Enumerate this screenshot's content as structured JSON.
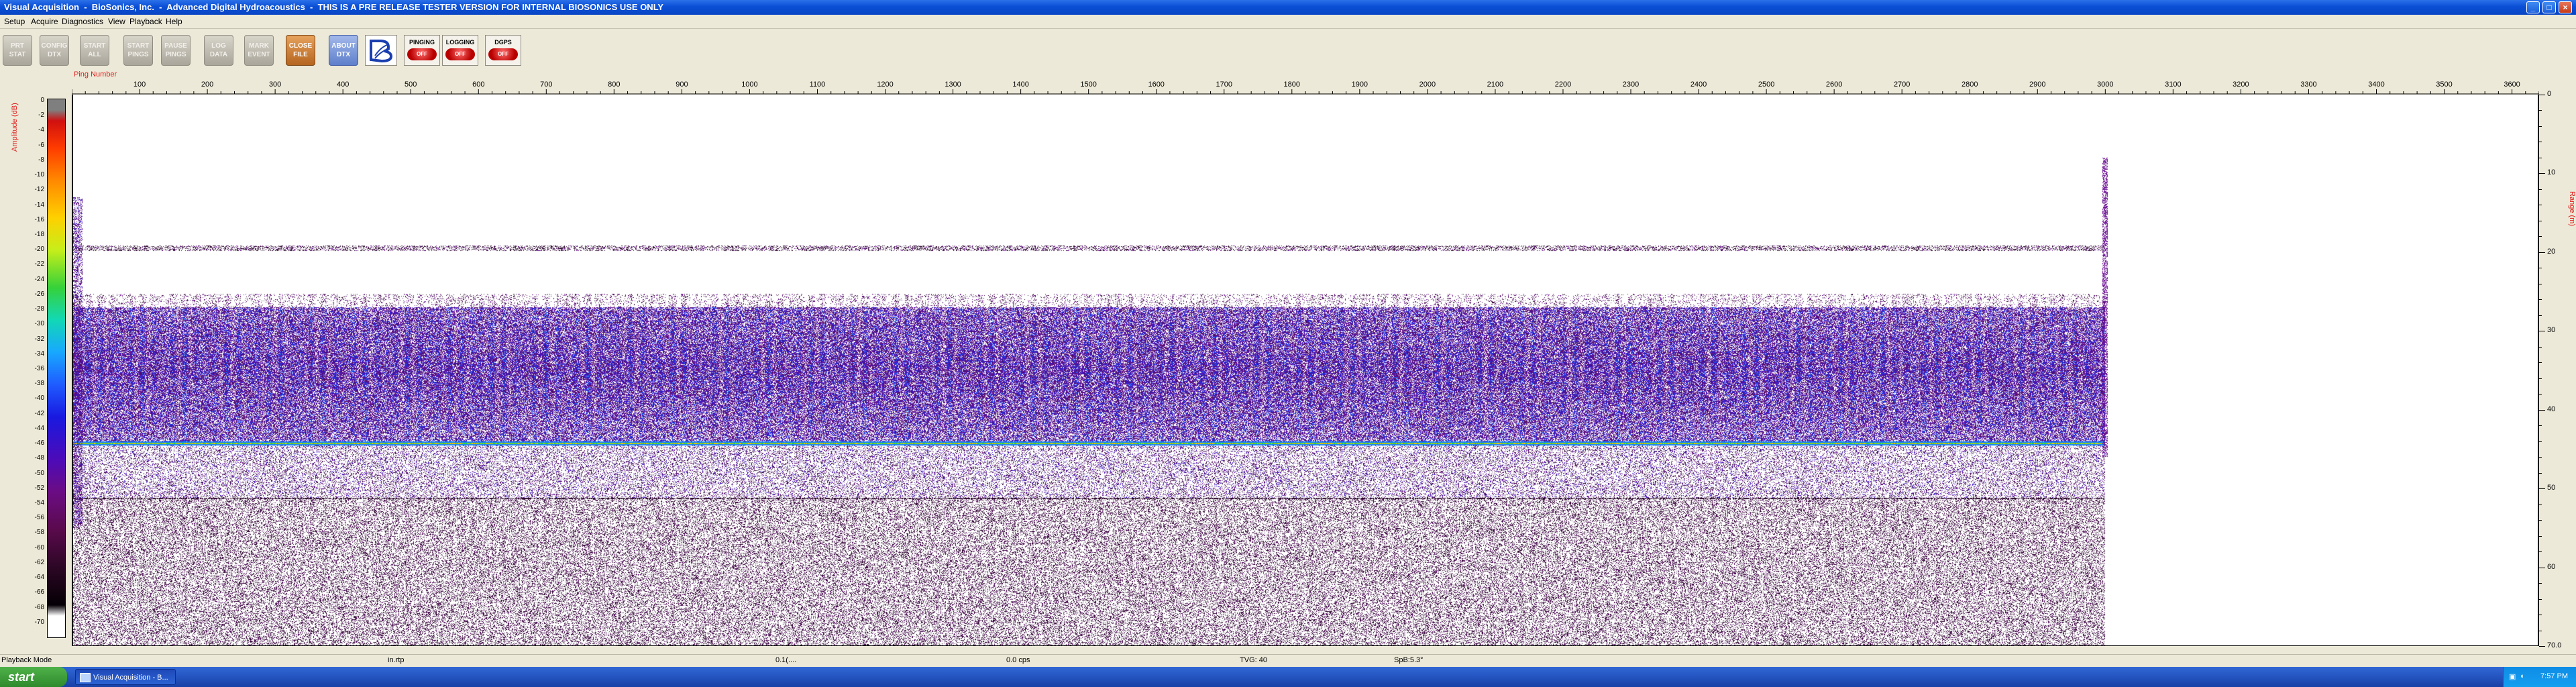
{
  "window": {
    "title": "Visual Acquisition  -  BioSonics, Inc.  -  Advanced Digital Hydroacoustics  -  THIS IS A PRE RELEASE TESTER VERSION FOR INTERNAL BIOSONICS USE ONLY",
    "minimize_label": "_",
    "maximize_label": "□",
    "close_label": "×"
  },
  "menu": [
    "Setup",
    "Acquire",
    "Diagnostics",
    "View",
    "Playback",
    "Help"
  ],
  "toolbar": {
    "buttons": [
      {
        "label": "PRT\nSTAT",
        "style": "gray"
      },
      {
        "label": "CONFIG\nDTX",
        "style": "gray"
      },
      {
        "label": "START\nALL",
        "style": "gray"
      },
      {
        "label": "START\nPINGS",
        "style": "gray"
      },
      {
        "label": "PAUSE\nPINGS",
        "style": "gray"
      },
      {
        "label": "LOG\nDATA",
        "style": "gray"
      },
      {
        "label": "MARK\nEVENT",
        "style": "gray"
      },
      {
        "label": "CLOSE\nFILE",
        "style": "orange"
      },
      {
        "label": "ABOUT\nDTX",
        "style": "blue"
      }
    ],
    "logo_icon": "biosonics-logo-icon",
    "indicators": [
      {
        "label": "PINGING",
        "state": "OFF",
        "color": "#c00000"
      },
      {
        "label": "LOGGING",
        "state": "OFF",
        "color": "#c00000"
      },
      {
        "label": "DGPS",
        "state": "OFF",
        "color": "#c00000"
      }
    ]
  },
  "echogram": {
    "x_axis_label": "Ping Number",
    "x_ticks": [
      100,
      200,
      300,
      400,
      500,
      600,
      700,
      800,
      900,
      1000,
      1100,
      1200,
      1300,
      1400,
      1500,
      1600,
      1700,
      1800,
      1900,
      2000,
      2100,
      2200,
      2300,
      2400,
      2500,
      2600,
      2700,
      2800,
      2900,
      3000,
      3100,
      3200,
      3300,
      3400,
      3500,
      3600
    ],
    "x_range": [
      0,
      3640
    ],
    "colorbar_label": "Amplitude (dB)",
    "colorbar_ticks": [
      0,
      -2,
      -4,
      -6,
      -8,
      -10,
      -12,
      -14,
      -16,
      -18,
      -20,
      -22,
      -24,
      -26,
      -28,
      -30,
      -32,
      -34,
      -36,
      -38,
      -40,
      -42,
      -44,
      -46,
      -48,
      -50,
      -52,
      -54,
      -56,
      -58,
      -60,
      -62,
      -64,
      -66,
      -68,
      -70
    ],
    "colorbar_range": [
      0,
      -72
    ],
    "depth_label": "Range (m)",
    "depth_ticks": [
      "0",
      "10",
      "20",
      "30",
      "40",
      "50",
      "60",
      "70.0"
    ],
    "depth_range": [
      0,
      70
    ],
    "data_end_ping": 3000,
    "bottom_depth_m": 44.3,
    "scatter_layer_m": [
      27,
      44
    ],
    "surface_noise_depth_m": 19.5,
    "secondary_bottom_m": 51.2
  },
  "statusbar": {
    "mode": "Playback Mode",
    "fields": [
      "in.rtp",
      "0.1(....",
      "0.0 cps",
      "TVG: 40",
      "SpB:5.3°"
    ]
  },
  "taskbar": {
    "start_label": "start",
    "task_label": "Visual Acquisition  -  B...",
    "clock": "7:57 PM"
  }
}
